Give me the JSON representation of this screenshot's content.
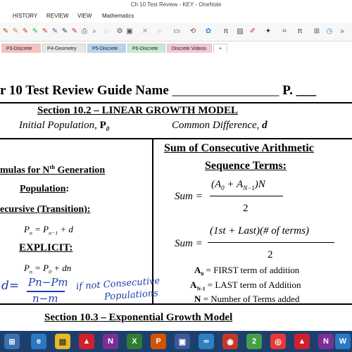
{
  "window": {
    "title": "Ch 10 Test Review - KEY - OneNote"
  },
  "menu": [
    "HISTORY",
    "REVIEW",
    "VIEW",
    "Mathematics"
  ],
  "toolbar": {
    "pi1": "π",
    "pi2": "π"
  },
  "tabs": [
    {
      "label": "P3-Discrete",
      "color": "#f6c1c1"
    },
    {
      "label": "P4-Geometry",
      "color": "#e7e7e7"
    },
    {
      "label": "P5-Discrete",
      "color": "#b8d3f0"
    },
    {
      "label": "P6-Discrete",
      "color": "#c9ead1"
    },
    {
      "label": "Discrete Videos",
      "color": "#f3c7d6"
    },
    {
      "label": "+",
      "color": "#ffffff"
    }
  ],
  "doc": {
    "title_prefix": "r 10 Test Review Guide  Name",
    "title_blank": "________________",
    "title_p": "P. ___",
    "s102_heading": "Section 10.2 – LINEAR GROWTH MODEL",
    "initial_population": "Initial Population, ",
    "p0": "P",
    "p0_sub": "0",
    "common_difference": "Common Difference, ",
    "d": "d",
    "formulas_line1": "mulas for N",
    "formulas_sup": "th",
    "formulas_line1b": " Generation",
    "population": "Population",
    "colon": ":",
    "recursive": "ecursive (Transition):",
    "recursive_formula": "P",
    "recursive_formula_rest": " = P",
    "recursive_formula_tail": " + d",
    "explicit": "EXPLICIT:",
    "explicit_tail": " + dn",
    "sum_heading1": "Sum of Consecutive Arithmetic",
    "sum_heading2": "Sequence Terms:",
    "sum_label": "Sum =",
    "sum1_top": "(A",
    "sum1_top2": " + A",
    "sum1_top3": ")N",
    "sum1_bottom": "2",
    "sum2_top": "(1st + Last)(#  of terms)",
    "sum2_bottom": "2",
    "a0_def": " = FIRST term of addition",
    "an_def": " = LAST term of Addition",
    "n_def": " = Number of Terms added",
    "a_letter": "A",
    "a0_sub": "0",
    "an_sub": "N-1",
    "n_letter": "N",
    "hand_d": "d=",
    "hand_num": "Pn−Pm",
    "hand_den": "n−m",
    "hand_note1": "if not Consecutive",
    "hand_note2": "Populations",
    "s103_heading": "Section 10.3 – Exponential Growth Model"
  },
  "colors": {
    "ink_blue": "#1c3fa8",
    "taskbar": "#1d3f6e"
  }
}
